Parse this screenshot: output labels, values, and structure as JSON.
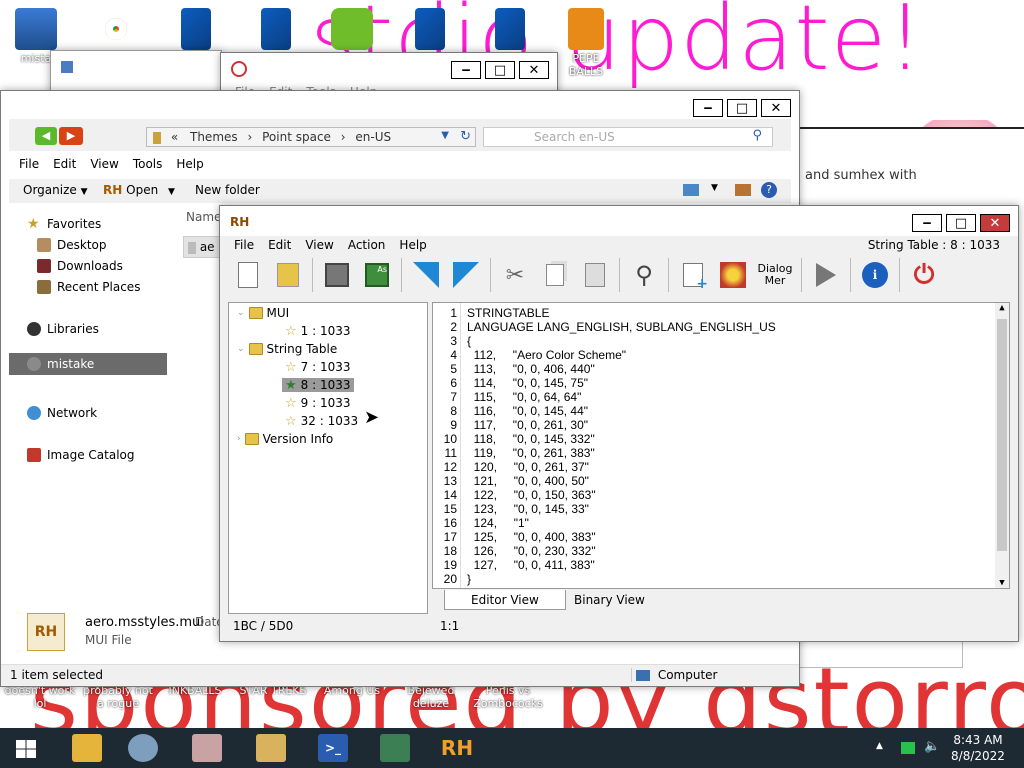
{
  "wallpaper": {
    "headline": "stdio update!",
    "sponsor": "sponsored by dstorro",
    "snippet": "and sumhex with"
  },
  "desktop_icons": [
    {
      "label": "mista",
      "icon": "computer-icon"
    },
    {
      "label": "",
      "icon": "chrome-icon"
    },
    {
      "label": "",
      "icon": "app-icon"
    },
    {
      "label": "",
      "icon": "app-icon"
    },
    {
      "label": "",
      "icon": "angry-birds-icon"
    },
    {
      "label": "",
      "icon": "app-icon"
    },
    {
      "label": "",
      "icon": "app-icon"
    },
    {
      "label": "PEPE BALLS",
      "icon": "game-icon"
    }
  ],
  "bottom_labels": [
    {
      "top": "doesn't work",
      "bottom": "lol"
    },
    {
      "top": "probably not",
      "bottom": "a rogue"
    },
    {
      "top": "INKBALLS",
      "bottom": ""
    },
    {
      "top": "STAR TREKS",
      "bottom": ""
    },
    {
      "top": "Among Us",
      "bottom": ""
    },
    {
      "top": "Bejewed",
      "bottom": "deluze"
    },
    {
      "top": "Penis vs",
      "bottom": "Zombococks"
    }
  ],
  "explorer": {
    "address": {
      "sep": "«",
      "crumbs": [
        "Themes",
        "Point space",
        "en-US"
      ]
    },
    "search_placeholder": "Search en-US",
    "menu": [
      "File",
      "Edit",
      "View",
      "Tools",
      "Help"
    ],
    "toolbar": {
      "organize": "Organize",
      "open": "Open",
      "new_folder": "New folder"
    },
    "column_header": "Name",
    "file_row_label": "ae",
    "sidebar": [
      {
        "label": "Favorites",
        "icon": "star-icon"
      },
      {
        "label": "Desktop",
        "icon": "desktop-icon"
      },
      {
        "label": "Downloads",
        "icon": "downloads-icon"
      },
      {
        "label": "Recent Places",
        "icon": "recent-icon"
      },
      {
        "label": "Libraries",
        "icon": "libraries-icon"
      },
      {
        "label": "mistake",
        "icon": "user-icon"
      },
      {
        "label": "Network",
        "icon": "network-icon"
      },
      {
        "label": "Image Catalog",
        "icon": "image-catalog-icon"
      }
    ],
    "details": {
      "filename": "aero.msstyles.mui",
      "type": "MUI File",
      "date_label": "Date"
    },
    "status": {
      "left": "1 item selected",
      "right": "Computer"
    }
  },
  "back_window": {
    "menu": [
      "File",
      "Edit",
      "Tools",
      "Help"
    ]
  },
  "rh": {
    "title_logo": "RH",
    "menu": [
      "File",
      "Edit",
      "View",
      "Action",
      "Help"
    ],
    "header_right": "String Table : 8 : 1033",
    "dialog_menu_label": "Dialog Mer",
    "tree": [
      {
        "label": "MUI",
        "type": "folder",
        "level": 0
      },
      {
        "label": "1 : 1033",
        "type": "star",
        "level": 1
      },
      {
        "label": "String Table",
        "type": "folder",
        "level": 0
      },
      {
        "label": "7 : 1033",
        "type": "star",
        "level": 1
      },
      {
        "label": "8 : 1033",
        "type": "star",
        "level": 1,
        "selected": true
      },
      {
        "label": "9 : 1033",
        "type": "star",
        "level": 1
      },
      {
        "label": "32 : 1033",
        "type": "star",
        "level": 1
      },
      {
        "label": "Version Info",
        "type": "folder",
        "level": 0
      }
    ],
    "code": [
      "STRINGTABLE",
      "LANGUAGE LANG_ENGLISH, SUBLANG_ENGLISH_US",
      "{",
      "  112,     \"Aero Color Scheme\"",
      "  113,     \"0, 0, 406, 440\"",
      "  114,     \"0, 0, 145, 75\"",
      "  115,     \"0, 0, 64, 64\"",
      "  116,     \"0, 0, 145, 44\"",
      "  117,     \"0, 0, 261, 30\"",
      "  118,     \"0, 0, 145, 332\"",
      "  119,     \"0, 0, 261, 383\"",
      "  120,     \"0, 0, 261, 37\"",
      "  121,     \"0, 0, 400, 50\"",
      "  122,     \"0, 0, 150, 363\"",
      "  123,     \"0, 0, 145, 33\"",
      "  124,     \"1\"",
      "  125,     \"0, 0, 400, 383\"",
      "  126,     \"0, 0, 230, 332\"",
      "  127,     \"0, 0, 411, 383\"",
      "}"
    ],
    "tabs": [
      "Editor View",
      "Binary View"
    ],
    "status_left": "1BC / 5D0",
    "status_right": "1:1"
  },
  "taskbar": {
    "time": "8:43 AM",
    "date": "8/8/2022",
    "app_label": "RH"
  }
}
